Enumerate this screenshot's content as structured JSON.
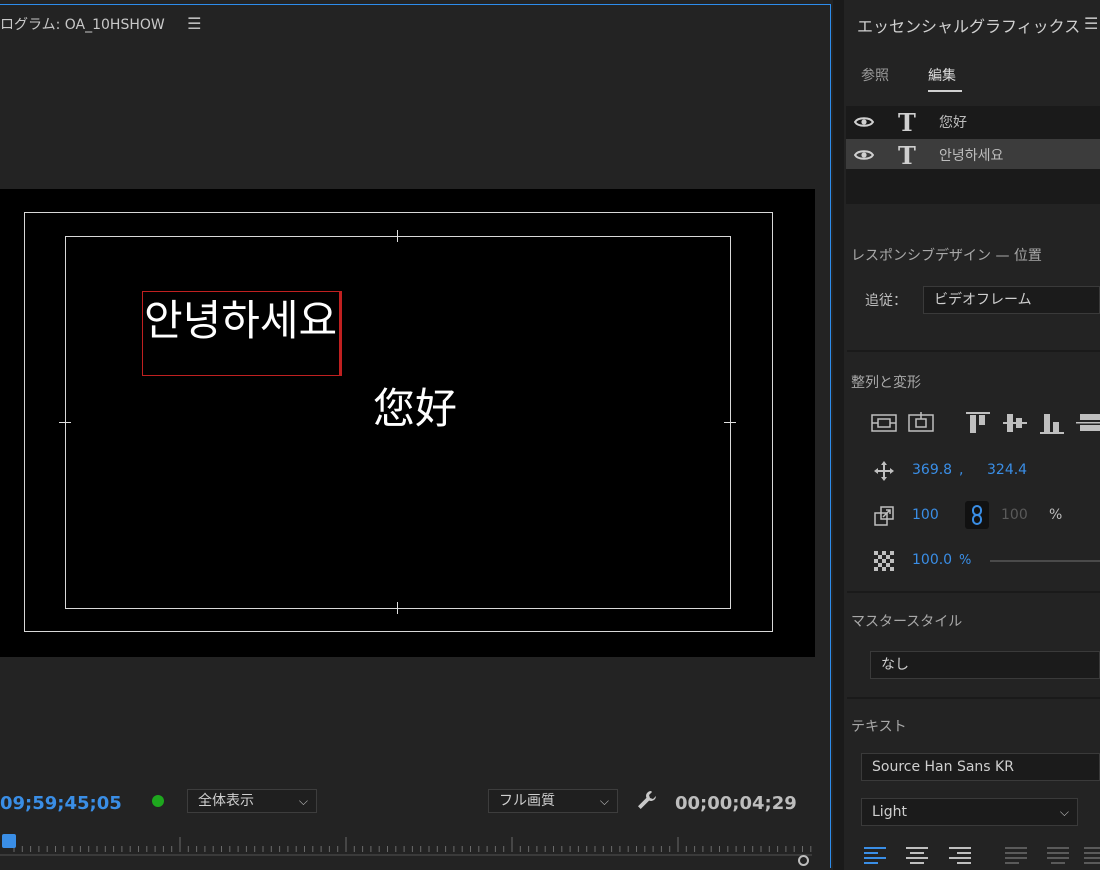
{
  "monitor": {
    "title": "ログラム: OA_10HSHOW",
    "menu_icon": "hamburger-icon",
    "canvas": {
      "text_korean": "안녕하세요",
      "text_chinese": "您好"
    },
    "timecode_current": "09;59;45;05",
    "zoom_select": "全体表示",
    "quality_select": "フル画質",
    "settings_icon": "wrench-icon",
    "timecode_duration": "00;00;04;29"
  },
  "panel": {
    "title": "エッセンシャルグラフィックス",
    "menu_icon": "hamburger-icon",
    "tabs": [
      {
        "label": "参照",
        "active": false
      },
      {
        "label": "編集",
        "active": true
      }
    ],
    "layers": [
      {
        "name": "您好",
        "selected": false
      },
      {
        "name": "안녕하세요",
        "selected": true
      }
    ],
    "responsive": {
      "title": "レスポンシブデザイン — 位置",
      "follow_label": "追従：",
      "follow_value": "ビデオフレーム"
    },
    "align": {
      "title": "整列と変形",
      "position_x": "369.8",
      "position_sep": ",",
      "position_y": "324.4",
      "scale": "100",
      "scale_linked": "100",
      "scale_unit": "%",
      "opacity": "100.0",
      "opacity_unit": "%"
    },
    "master_style": {
      "title": "マスタースタイル",
      "value": "なし"
    },
    "text": {
      "title": "テキスト",
      "font": "Source Han Sans KR",
      "weight": "Light"
    }
  },
  "colors": {
    "accent": "#3a8ee6",
    "selection_red": "#c02020",
    "live_green": "#1ea71e"
  }
}
